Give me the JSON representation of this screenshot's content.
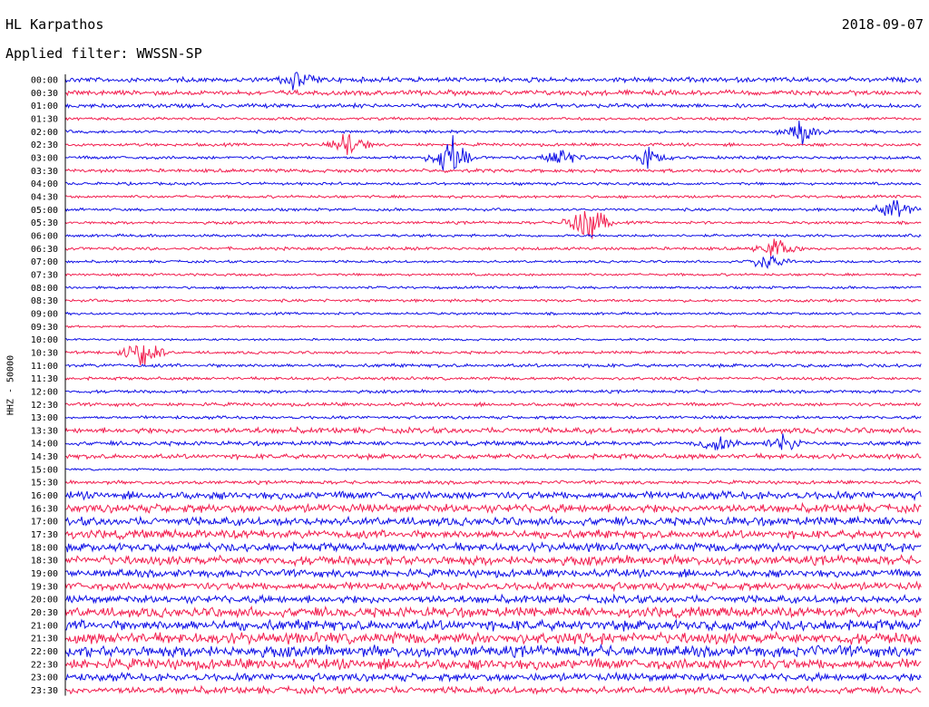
{
  "header": {
    "station": "HL Karpathos",
    "date": "2018-09-07",
    "filter_prefix": "Applied filter: ",
    "filter_name": "WWSSN-SP",
    "channel": "HHZ - 50000"
  },
  "colors": {
    "a": "#1010e6",
    "b": "#f21e4f",
    "frame": "#000000"
  },
  "chart_data": {
    "type": "line",
    "title": "HL Karpathos",
    "ylabel": "HHZ - 50000",
    "xlabel": "",
    "rows": [
      "00:00",
      "00:30",
      "01:00",
      "01:30",
      "02:00",
      "02:30",
      "03:00",
      "03:30",
      "04:00",
      "04:30",
      "05:00",
      "05:30",
      "06:00",
      "06:30",
      "07:00",
      "07:30",
      "08:00",
      "08:30",
      "09:00",
      "09:30",
      "10:00",
      "10:30",
      "11:00",
      "11:30",
      "12:00",
      "12:30",
      "13:00",
      "13:30",
      "14:00",
      "14:30",
      "15:00",
      "15:30",
      "16:00",
      "16:30",
      "17:00",
      "17:30",
      "18:00",
      "18:30",
      "19:00",
      "19:30",
      "20:00",
      "20:30",
      "21:00",
      "21:30",
      "22:00",
      "22:30",
      "23:00",
      "23:30"
    ],
    "row_color_cycle": [
      "a",
      "b"
    ],
    "noise_level": [
      0.35,
      0.35,
      0.3,
      0.2,
      0.22,
      0.22,
      0.22,
      0.25,
      0.2,
      0.2,
      0.2,
      0.2,
      0.2,
      0.22,
      0.18,
      0.18,
      0.18,
      0.2,
      0.18,
      0.15,
      0.15,
      0.2,
      0.25,
      0.22,
      0.22,
      0.25,
      0.22,
      0.4,
      0.3,
      0.35,
      0.15,
      0.25,
      0.55,
      0.6,
      0.6,
      0.6,
      0.6,
      0.65,
      0.55,
      0.55,
      0.55,
      0.7,
      0.75,
      0.8,
      0.8,
      0.75,
      0.55,
      0.5
    ],
    "events": [
      {
        "row": "00:00",
        "x": 0.27,
        "amp": 1.3
      },
      {
        "row": "02:00",
        "x": 0.86,
        "amp": 1.6
      },
      {
        "row": "02:30",
        "x": 0.33,
        "amp": 2.0
      },
      {
        "row": "03:00",
        "x": 0.45,
        "amp": 3.0
      },
      {
        "row": "03:00",
        "x": 0.58,
        "amp": 1.5
      },
      {
        "row": "03:00",
        "x": 0.68,
        "amp": 1.2
      },
      {
        "row": "05:30",
        "x": 0.61,
        "amp": 4.0
      },
      {
        "row": "05:00",
        "x": 0.97,
        "amp": 2.0
      },
      {
        "row": "06:30",
        "x": 0.83,
        "amp": 1.5
      },
      {
        "row": "07:00",
        "x": 0.82,
        "amp": 1.5
      },
      {
        "row": "10:30",
        "x": 0.09,
        "amp": 2.5
      },
      {
        "row": "14:00",
        "x": 0.76,
        "amp": 1.4
      },
      {
        "row": "14:00",
        "x": 0.84,
        "amp": 1.4
      }
    ]
  }
}
